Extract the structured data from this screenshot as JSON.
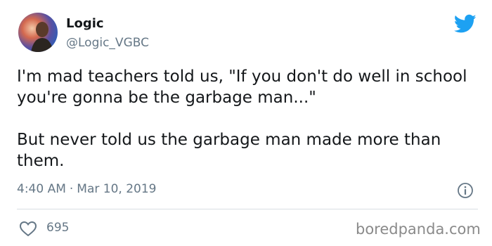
{
  "author": {
    "display_name": "Logic",
    "handle": "@Logic_VGBC",
    "avatar_icon": "profile-photo",
    "platform_icon": "twitter-bird-icon",
    "platform_color": "#1da1f2"
  },
  "tweet": {
    "paragraphs": [
      "I'm mad teachers told us, \"If you don't do well in school you're gonna be the garbage man...\"",
      "But never told us the garbage man made more than them."
    ],
    "time": "4:40 AM",
    "separator": "·",
    "date": "Mar 10, 2019"
  },
  "engagement": {
    "like_icon": "heart-icon",
    "likes": "695",
    "info_icon": "info-icon"
  },
  "watermark": "boredpanda.com"
}
